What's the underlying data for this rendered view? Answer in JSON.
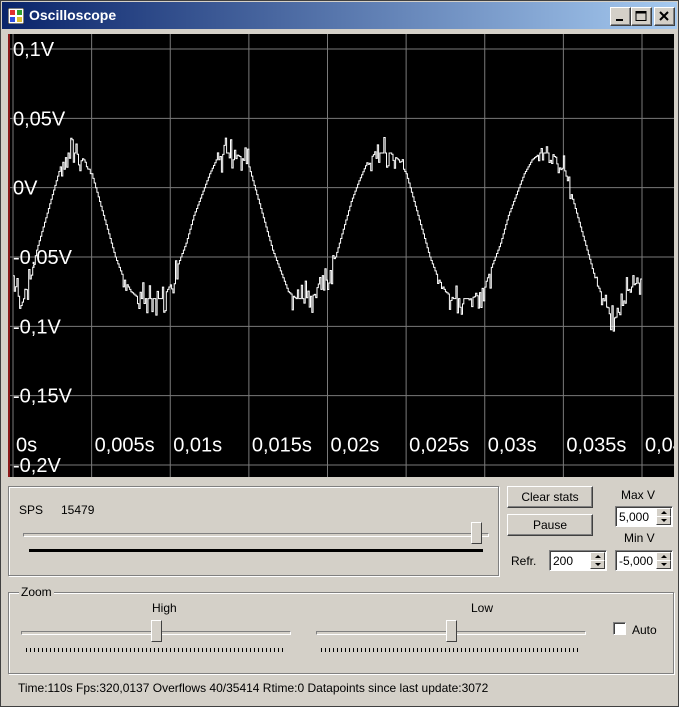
{
  "window": {
    "title": "Oscilloscope",
    "icon": "oscilloscope-app-icon"
  },
  "titlebar_buttons": {
    "minimize_icon": "minimize-icon",
    "maximize_icon": "maximize-icon",
    "close_icon": "close-icon"
  },
  "chart_data": {
    "type": "line",
    "y_labels": [
      "0,1V",
      "0,05V",
      "0V",
      "-0,05V",
      "-0,1V",
      "-0,15V",
      "-0,2V"
    ],
    "x_labels": [
      "0s",
      "0,005s",
      "0,01s",
      "0,015s",
      "0,02s",
      "0,025s",
      "0,03s",
      "0,035s",
      "0,04"
    ],
    "ylim": [
      -0.2,
      0.1
    ],
    "xlim": [
      0,
      0.04
    ],
    "grid": true,
    "colors": {
      "background": "#000000",
      "grid": "#7a7a7a",
      "trace": "#ffffff",
      "text": "#ffffff"
    },
    "series": [
      {
        "x": [
          0,
          0.0005,
          0.001,
          0.0015,
          0.002,
          0.0025,
          0.003,
          0.0035,
          0.004,
          0.0045,
          0.005,
          0.0055,
          0.006,
          0.0065,
          0.007,
          0.0075,
          0.008,
          0.0085,
          0.009,
          0.0095,
          0.01,
          0.0105,
          0.011,
          0.0115,
          0.012,
          0.0125,
          0.013,
          0.0135,
          0.014,
          0.0145,
          0.015,
          0.0155,
          0.016,
          0.0165,
          0.017,
          0.0175,
          0.018,
          0.0185,
          0.019,
          0.0195,
          0.02,
          0.0205,
          0.021,
          0.0215,
          0.022,
          0.0225,
          0.023,
          0.0235,
          0.024,
          0.0245,
          0.025,
          0.0255,
          0.026,
          0.0265,
          0.027,
          0.0275,
          0.028,
          0.0285,
          0.029,
          0.0295,
          0.03,
          0.0305,
          0.031,
          0.0315,
          0.032,
          0.0325,
          0.033,
          0.0335,
          0.034,
          0.0345,
          0.035,
          0.0355,
          0.036,
          0.0365,
          0.037,
          0.0375,
          0.038,
          0.0385,
          0.039,
          0.0395,
          0.04
        ],
        "y": [
          -0.065,
          -0.085,
          -0.07,
          -0.045,
          -0.025,
          -0.005,
          0.015,
          0.025,
          0.025,
          0.02,
          0.01,
          -0.01,
          -0.03,
          -0.05,
          -0.065,
          -0.075,
          -0.08,
          -0.08,
          -0.08,
          -0.08,
          -0.07,
          -0.055,
          -0.04,
          -0.02,
          -0.005,
          0.01,
          0.022,
          0.025,
          0.025,
          0.022,
          0.015,
          -0.005,
          -0.025,
          -0.045,
          -0.06,
          -0.075,
          -0.08,
          -0.08,
          -0.078,
          -0.075,
          -0.065,
          -0.05,
          -0.03,
          -0.01,
          0.005,
          0.018,
          0.025,
          0.025,
          0.025,
          0.02,
          0.01,
          -0.01,
          -0.03,
          -0.05,
          -0.065,
          -0.075,
          -0.08,
          -0.08,
          -0.08,
          -0.078,
          -0.07,
          -0.055,
          -0.04,
          -0.02,
          -0.005,
          0.01,
          0.02,
          0.025,
          0.025,
          0.022,
          0.015,
          -0.005,
          -0.025,
          -0.045,
          -0.065,
          -0.08,
          -0.09,
          -0.095,
          -0.075,
          -0.07,
          -0.065
        ]
      }
    ]
  },
  "sps": {
    "label": "SPS",
    "value": "15479",
    "slider_fraction": 1.0
  },
  "buttons": {
    "clear_stats": "Clear stats",
    "pause": "Pause"
  },
  "refresh": {
    "label": "Refr.",
    "value": "200"
  },
  "max_v": {
    "label": "Max V",
    "value": "5,000"
  },
  "min_v": {
    "label": "Min V",
    "value": "-5,000"
  },
  "zoom": {
    "legend": "Zoom",
    "high_label": "High",
    "low_label": "Low",
    "high_fraction": 0.5,
    "low_fraction": 0.5,
    "auto_label": "Auto",
    "auto_checked": false
  },
  "status_bar": {
    "text": "Time:110s Fps:320,0137 Overflows 40/35414 Rtime:0 Datapoints since last update:3072"
  }
}
